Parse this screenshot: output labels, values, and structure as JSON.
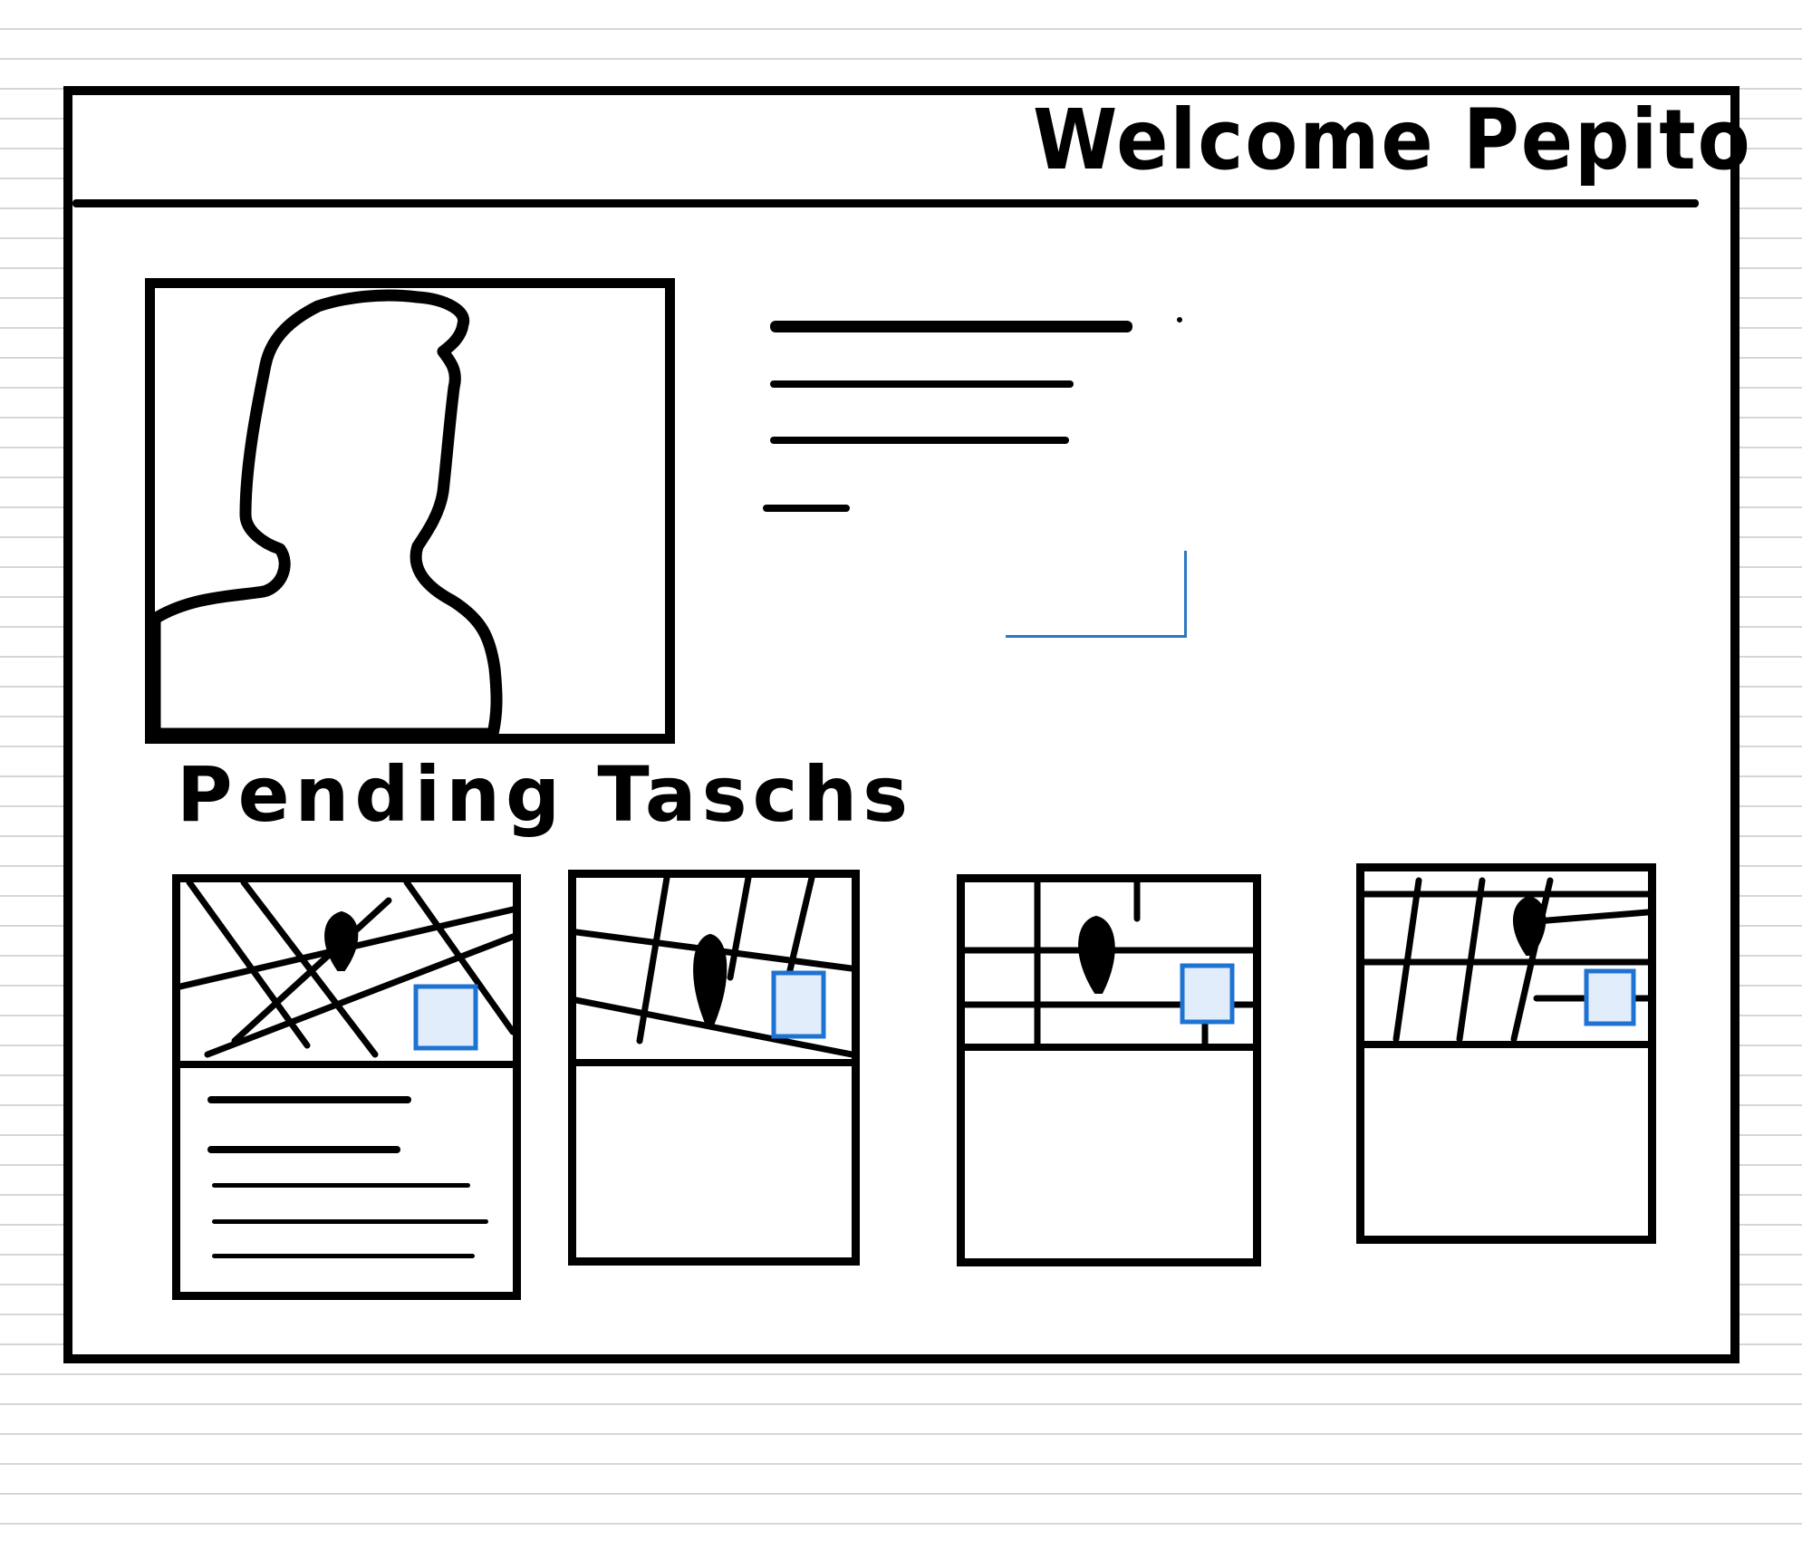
{
  "header": {
    "title": "Welcome Pepito"
  },
  "profile": {
    "avatar_icon": "person-silhouette-icon"
  },
  "tasks": {
    "heading": "Pending Taschs",
    "map_icon": "map-pin-icon",
    "marker_icon": "selection-square-icon",
    "marker_color": "#1e73d2",
    "marker_fill": "#e1edfa",
    "count": 4
  }
}
